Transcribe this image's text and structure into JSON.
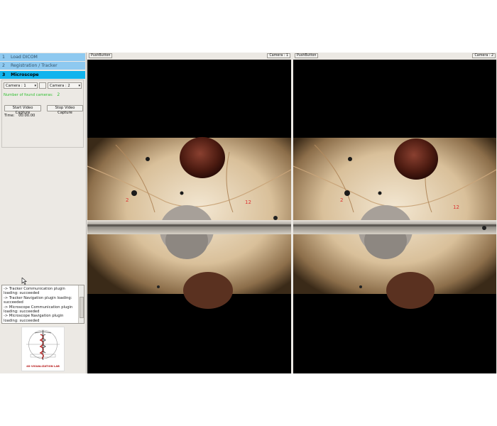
{
  "sidebar": {
    "steps": [
      {
        "num": "1",
        "label": "Load DICOM"
      },
      {
        "num": "2",
        "label": "Registration / Tracker"
      },
      {
        "num": "3",
        "label": "Microscope"
      }
    ]
  },
  "microscope": {
    "camera_left": "Camera : 1",
    "camera_right": "Camera : 2",
    "found_label": "Number of found cameras:",
    "found_value": "2",
    "start_label": "Start Video Capture",
    "stop_label": "Stop Video Capture",
    "time_label": "Time:",
    "time_value": "00:00.00"
  },
  "log": {
    "lines": [
      "-> Tracker Communication plugin loading: succeeded",
      "-> Tracker Navigation plugin loading: succeeded",
      "-> Microscope Communication plugin loading: succeeded",
      "-> Microscope Navigation plugin loading: succeeded"
    ]
  },
  "logo": {
    "text": "4D VISUALIZATION LAB"
  },
  "views": [
    {
      "push_label": "PushButton",
      "camera_label": "Camera : 1"
    },
    {
      "push_label": "PushButton",
      "camera_label": "Camera : 2"
    }
  ],
  "colors": {
    "step_inactive": "#8ec9f0",
    "step_active": "#11b4ee",
    "found_text": "#2fbf2f"
  }
}
